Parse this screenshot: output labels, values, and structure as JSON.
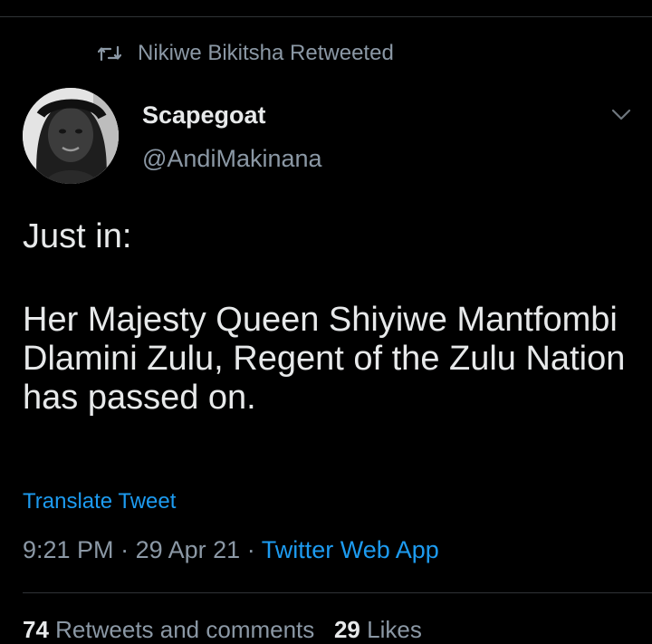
{
  "retweet_banner": {
    "icon": "retweet-icon",
    "text": "Nikiwe Bikitsha Retweeted"
  },
  "author": {
    "display_name": "Scapegoat",
    "handle": "@AndiMakinana",
    "avatar_icon": "avatar"
  },
  "tweet": {
    "line_1": "Just in:",
    "line_2": "Her Majesty Queen Shiyiwe Mantfombi Dlamini Zulu, Regent of the Zulu Nation has passed on."
  },
  "translate_label": "Translate Tweet",
  "meta": {
    "time": "9:21 PM",
    "separator": "·",
    "date": "29 Apr 21",
    "source": "Twitter Web App"
  },
  "stats": {
    "retweets_count": "74",
    "retweets_label": "Retweets and comments",
    "likes_count": "29",
    "likes_label": "Likes"
  },
  "colors": {
    "background": "#000000",
    "text": "#e7e9ea",
    "muted": "#8b98a5",
    "link": "#1d9bf0"
  }
}
